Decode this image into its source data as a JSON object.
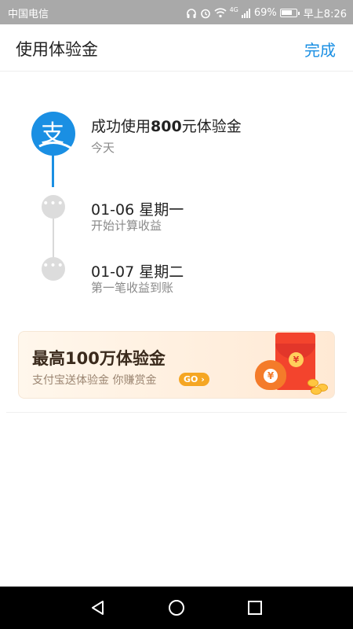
{
  "status_bar": {
    "carrier": "中国电信",
    "signal_label": "4G",
    "battery": "69%",
    "time": "早上8:26"
  },
  "header": {
    "title": "使用体验金",
    "done_label": "完成"
  },
  "timeline": {
    "steps": [
      {
        "title_prefix": "成功使用",
        "title_amount": "800",
        "title_suffix": "元体验金",
        "subtitle": "今天"
      },
      {
        "title": "01-06 星期一",
        "subtitle": "开始计算收益"
      },
      {
        "title": "01-07 星期二",
        "subtitle": "第一笔收益到账"
      }
    ],
    "dot_glyph": "•••",
    "logo_glyph": "支"
  },
  "banner": {
    "title": "最高100万体验金",
    "subtitle": "支付宝送体验金   你赚赏金",
    "go_label": "GO ›",
    "yuan_glyph": "¥"
  },
  "colors": {
    "accent": "#1a8fe3",
    "status_bar": "#a9a9a9",
    "banner_bg": "#ffe9d4",
    "red_envelope": "#f3442d",
    "go_button": "#f5a623"
  },
  "icons": {
    "headphones": "headphones-icon",
    "alarm": "alarm-icon",
    "wifi": "wifi-icon",
    "signal": "signal-icon",
    "battery": "battery-icon",
    "alipay_logo": "alipay-logo-icon",
    "nav_back": "back-triangle-icon",
    "nav_home": "home-circle-icon",
    "nav_recent": "recent-square-icon"
  }
}
